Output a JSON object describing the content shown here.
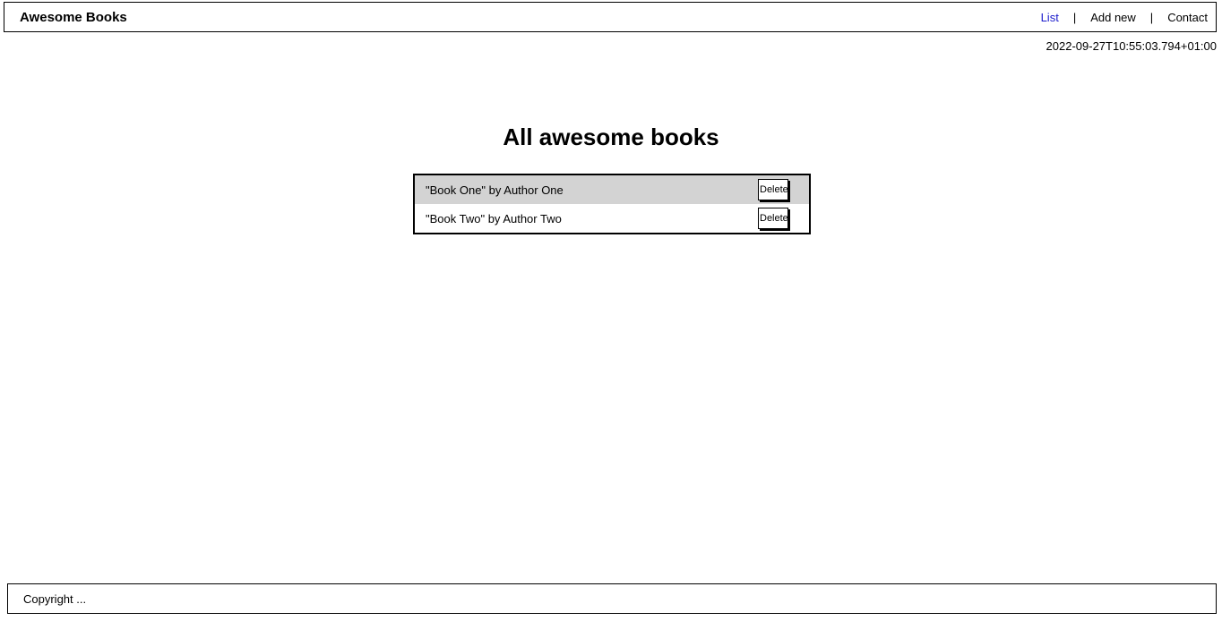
{
  "header": {
    "brand": "Awesome Books",
    "nav": [
      {
        "label": "List",
        "active": true
      },
      {
        "label": "Add new",
        "active": false
      },
      {
        "label": "Contact",
        "active": false
      }
    ],
    "separator": "|",
    "active_color": "#1a1acc"
  },
  "datetime": "2022-09-27T10:55:03.794+01:00",
  "main": {
    "title": "All awesome books",
    "books": [
      {
        "text": "\"Book One\" by Author One",
        "delete_label": "Delete"
      },
      {
        "text": "\"Book Two\" by Author Two",
        "delete_label": "Delete"
      }
    ],
    "row_shade_color": "#d3d3d3"
  },
  "footer": {
    "text": "Copyright ..."
  }
}
